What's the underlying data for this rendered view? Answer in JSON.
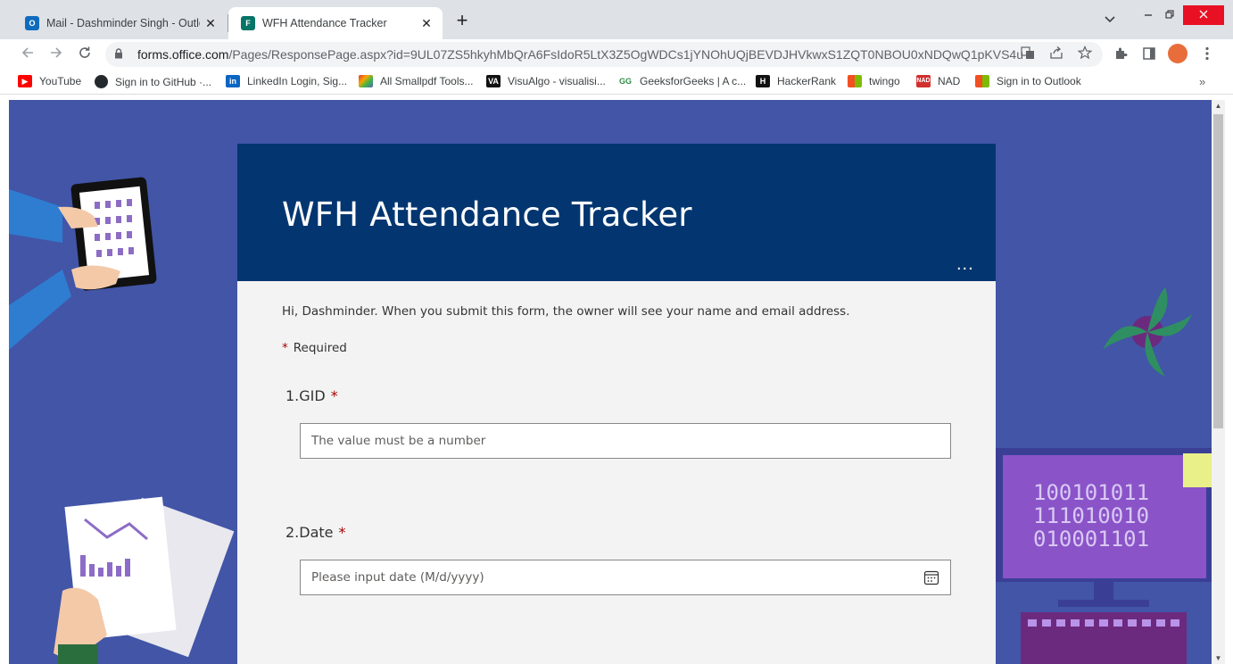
{
  "browser": {
    "tabs": [
      {
        "title": "Mail - Dashminder Singh - Outlo",
        "icon": "outlook-icon",
        "active": false
      },
      {
        "title": "WFH Attendance Tracker",
        "icon": "forms-icon",
        "active": true
      }
    ],
    "tab_close_glyph": "✕",
    "new_tab_glyph": "+",
    "url_host": "forms.office.com",
    "url_path": "/Pages/ResponsePage.aspx?id=9UL07ZS5hkyhMbQrA6FsIdoR5LtX3Z5OgWDCs1jYNOhUQjBEVDJHVkwxS1ZQT0NBOU0xNDQwQ1pKVS4u",
    "bookmarks": [
      {
        "label": "YouTube",
        "icon": "youtube-icon",
        "color": "#ff0000"
      },
      {
        "label": "Sign in to GitHub ·...",
        "icon": "github-icon",
        "color": "#24292e"
      },
      {
        "label": "LinkedIn Login, Sig...",
        "icon": "linkedin-icon",
        "color": "#0a66c2"
      },
      {
        "label": "All Smallpdf Tools...",
        "icon": "smallpdf-icon",
        "color": "#e5322d"
      },
      {
        "label": "VisuAlgo - visualisi...",
        "icon": "visualgo-icon",
        "color": "#111111"
      },
      {
        "label": "GeeksforGeeks | A c...",
        "icon": "geeksforgeeks-icon",
        "color": "#2f8d46"
      },
      {
        "label": "HackerRank",
        "icon": "hackerrank-icon",
        "color": "#111111"
      },
      {
        "label": "twingo",
        "icon": "microsoft-icon",
        "color": "#f25022"
      },
      {
        "label": "NAD",
        "icon": "nad-icon",
        "color": "#d32f2f"
      },
      {
        "label": "Sign in to Outlook",
        "icon": "microsoft-icon",
        "color": "#f25022"
      }
    ],
    "more_bookmarks_glyph": "»"
  },
  "form": {
    "title": "WFH Attendance Tracker",
    "more_glyph": "...",
    "intro": "Hi, Dashminder. When you submit this form, the owner will see your name and email address.",
    "required_star": "*",
    "required_label": "Required",
    "questions": [
      {
        "number": "1.",
        "label": "GID",
        "required": true,
        "placeholder": "The value must be a number",
        "type": "number"
      },
      {
        "number": "2.",
        "label": "Date",
        "required": true,
        "placeholder": "Please input date (M/d/yyyy)",
        "type": "date"
      }
    ],
    "header_color": "#033670",
    "background_color": "#4255a7",
    "accent_required": "#a80000"
  }
}
